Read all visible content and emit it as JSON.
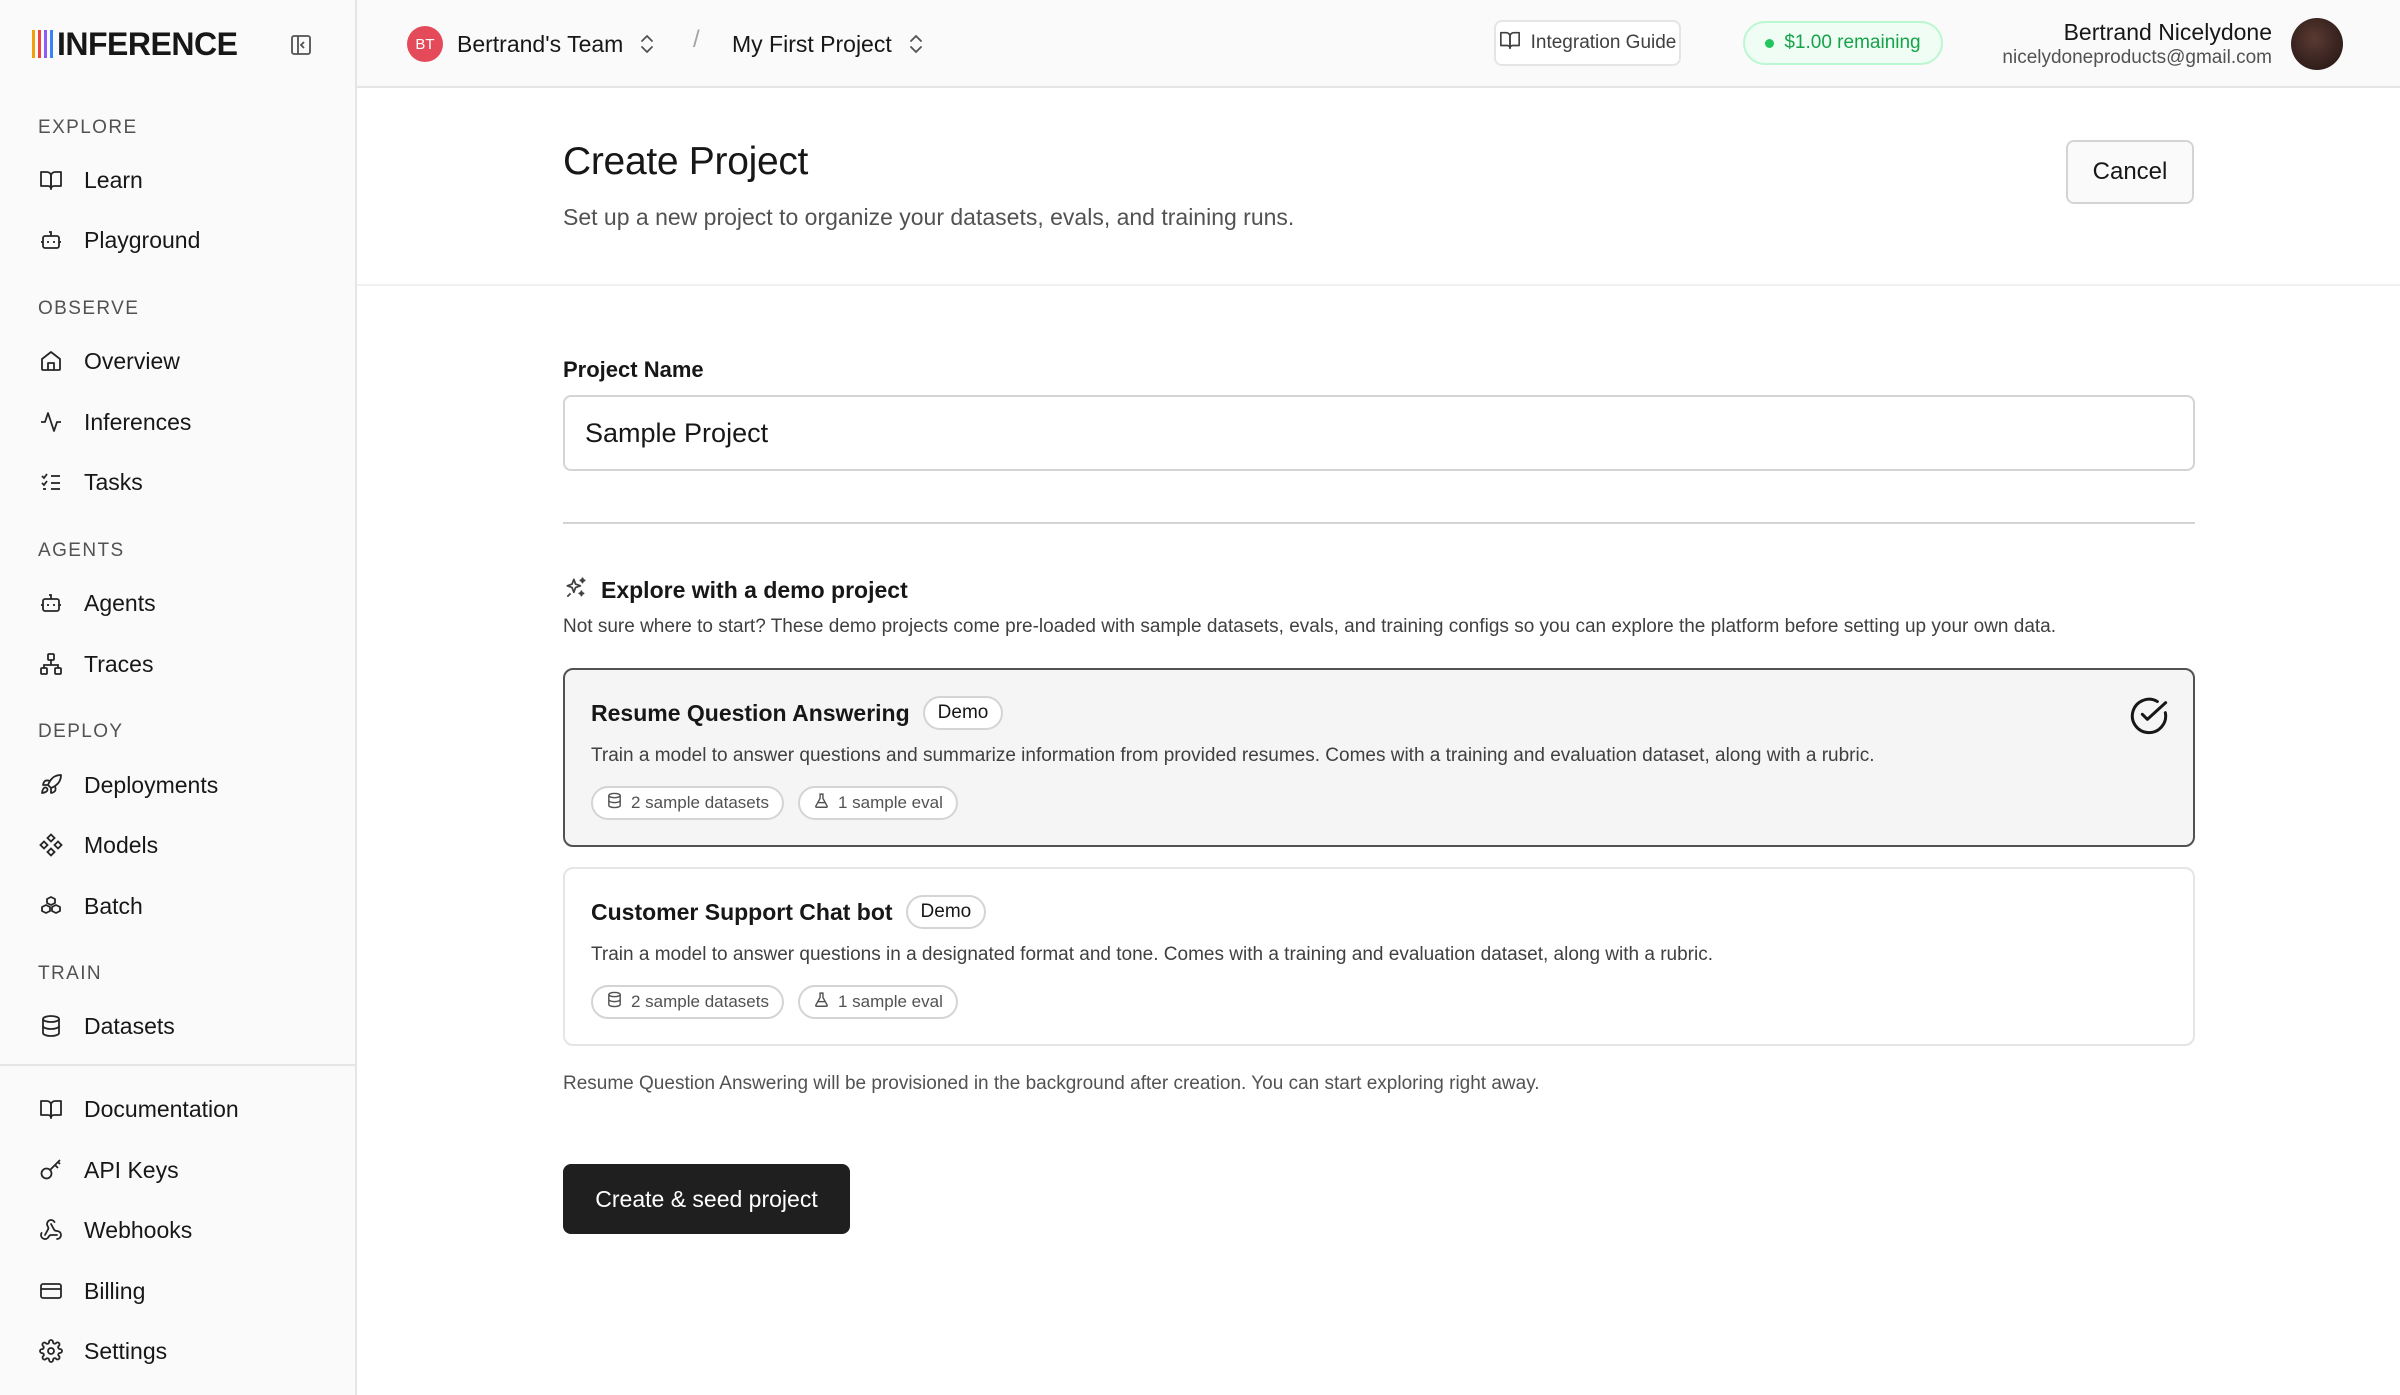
{
  "brand": {
    "name": "INFERENCE",
    "bar_colors": [
      "#f59e0b",
      "#ef4444",
      "#8b5cf6",
      "#3b82f6"
    ]
  },
  "sidebar": {
    "collapse_icon": "sidebar-collapse-icon",
    "sections": [
      {
        "label": "EXPLORE",
        "items": [
          {
            "label": "Learn",
            "icon": "book-open-icon"
          },
          {
            "label": "Playground",
            "icon": "bot-icon"
          }
        ]
      },
      {
        "label": "OBSERVE",
        "items": [
          {
            "label": "Overview",
            "icon": "home-icon"
          },
          {
            "label": "Inferences",
            "icon": "activity-icon"
          },
          {
            "label": "Tasks",
            "icon": "list-checks-icon"
          }
        ]
      },
      {
        "label": "AGENTS",
        "items": [
          {
            "label": "Agents",
            "icon": "bot-icon"
          },
          {
            "label": "Traces",
            "icon": "network-icon"
          }
        ]
      },
      {
        "label": "DEPLOY",
        "items": [
          {
            "label": "Deployments",
            "icon": "rocket-icon"
          },
          {
            "label": "Models",
            "icon": "diamond-nodes-icon"
          },
          {
            "label": "Batch",
            "icon": "boxes-icon"
          }
        ]
      },
      {
        "label": "TRAIN",
        "items": [
          {
            "label": "Datasets",
            "icon": "database-icon"
          }
        ]
      }
    ],
    "footer_items": [
      {
        "label": "Documentation",
        "icon": "book-open-icon"
      },
      {
        "label": "API Keys",
        "icon": "key-icon"
      },
      {
        "label": "Webhooks",
        "icon": "webhook-icon"
      },
      {
        "label": "Billing",
        "icon": "credit-card-icon"
      },
      {
        "label": "Settings",
        "icon": "gear-icon"
      }
    ]
  },
  "topbar": {
    "team": {
      "initials": "BT",
      "name": "Bertrand's Team",
      "avatar_color": "#e54a5a"
    },
    "separator": "/",
    "project": {
      "name": "My First Project"
    },
    "integration_guide": "Integration Guide",
    "credits": "$1.00 remaining",
    "user": {
      "name": "Bertrand Nicelydone",
      "email": "nicelydoneproducts@gmail.com"
    }
  },
  "page": {
    "title": "Create Project",
    "subtitle": "Set up a new project to organize your datasets, evals, and training runs.",
    "cancel_label": "Cancel",
    "project_name_label": "Project Name",
    "project_name_value": "Sample Project",
    "demo_heading": "Explore with a demo project",
    "demo_description": "Not sure where to start? These demo projects come pre-loaded with sample datasets, evals, and training configs so you can explore the platform before setting up your own data.",
    "demo_projects": [
      {
        "title": "Resume Question Answering",
        "badge": "Demo",
        "description": "Train a model to answer questions and summarize information from provided resumes. Comes with a training and evaluation dataset, along with a rubric.",
        "datasets": "2 sample datasets",
        "evals": "1 sample eval",
        "selected": true
      },
      {
        "title": "Customer Support Chat bot",
        "badge": "Demo",
        "description": "Train a model to answer questions in a designated format and tone. Comes with a training and evaluation dataset, along with a rubric.",
        "datasets": "2 sample datasets",
        "evals": "1 sample eval",
        "selected": false
      }
    ],
    "provision_note": "Resume Question Answering will be provisioned in the background after creation. You can start exploring right away.",
    "create_label": "Create & seed project"
  }
}
